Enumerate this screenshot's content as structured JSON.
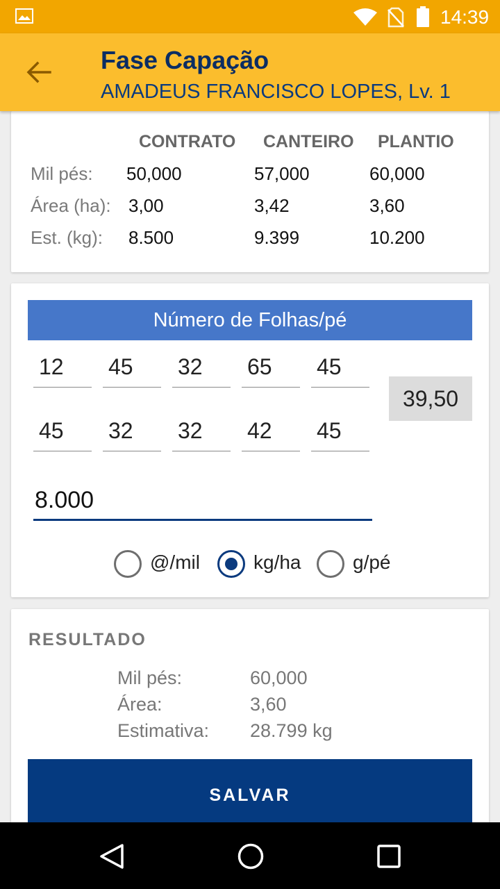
{
  "status_bar": {
    "time": "14:39",
    "icons": [
      "gallery-icon",
      "wifi-icon",
      "no-sim-icon",
      "battery-icon"
    ]
  },
  "app_bar": {
    "title": "Fase Capação",
    "subtitle": "AMADEUS FRANCISCO LOPES, Lv. 1",
    "back_icon": "arrow-back-icon"
  },
  "summary": {
    "columns": [
      "CONTRATO",
      "CANTEIRO",
      "PLANTIO"
    ],
    "rows": [
      {
        "label": "Mil pés:",
        "values": [
          "50,000",
          "57,000",
          "60,000"
        ]
      },
      {
        "label": "Área (ha):",
        "values": [
          "3,00",
          "3,42",
          "3,60"
        ]
      },
      {
        "label": "Est. (kg):",
        "values": [
          "8.500",
          "9.399",
          "10.200"
        ]
      }
    ]
  },
  "leaves": {
    "title": "Número de Folhas/pé",
    "row1": [
      "12",
      "45",
      "32",
      "65",
      "45"
    ],
    "row2": [
      "45",
      "32",
      "32",
      "42",
      "45"
    ],
    "average": "39,50",
    "weight": "8.000",
    "units": [
      {
        "label": "@/mil",
        "checked": false
      },
      {
        "label": "kg/ha",
        "checked": true
      },
      {
        "label": "g/pé",
        "checked": false
      }
    ]
  },
  "result": {
    "title": "RESULTADO",
    "rows": [
      {
        "label": "Mil pés:",
        "value": "60,000"
      },
      {
        "label": "Área:",
        "value": "3,60"
      },
      {
        "label": "Estimativa:",
        "value": "28.799 kg"
      }
    ],
    "save_label": "SALVAR"
  },
  "nav": {
    "icons": [
      "back-triangle-icon",
      "home-circle-icon",
      "recents-square-icon"
    ]
  },
  "colors": {
    "status_bar": "#f2a600",
    "app_bar": "#fbbd2d",
    "title_text": "#0b2d63",
    "banner": "#4677c9",
    "primary": "#053a80"
  }
}
